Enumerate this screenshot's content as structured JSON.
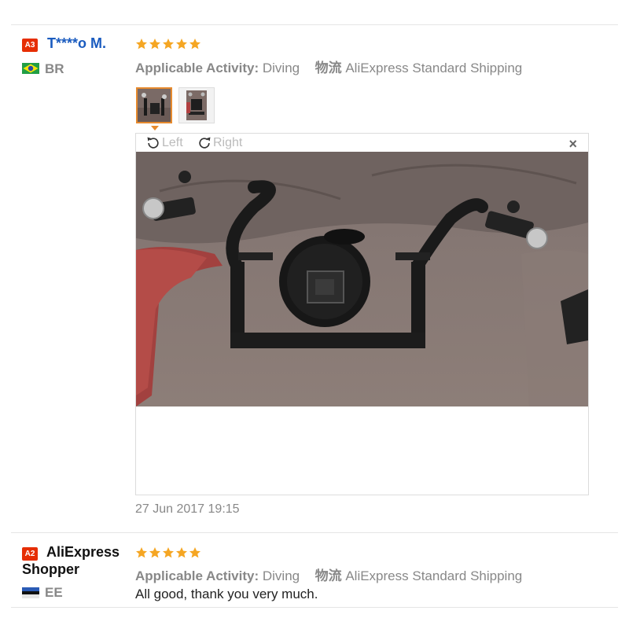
{
  "reviews": [
    {
      "level": "A3",
      "name": "T****o M.",
      "country": "BR",
      "rating": 5,
      "activity_label": "Applicable Activity:",
      "activity_value": "Diving",
      "logistics_label": "物流",
      "logistics_value": "AliExpress Standard Shipping",
      "viewer": {
        "rotate_left": "Left",
        "rotate_right": "Right",
        "close": "×"
      },
      "date": "27 Jun 2017 19:15"
    },
    {
      "level": "A2",
      "name_line1": "AliExpress",
      "name_line2": "Shopper",
      "country": "EE",
      "rating": 5,
      "activity_label": "Applicable Activity:",
      "activity_value": "Diving",
      "logistics_label": "物流",
      "logistics_value": "AliExpress Standard Shipping",
      "comment": "All good, thank you very much."
    }
  ],
  "colors": {
    "accent": "#e62e04",
    "star": "#f5a623",
    "link": "#1a5bbf",
    "muted": "#888888"
  },
  "icons": [
    "star-icon",
    "rotate-left-icon",
    "rotate-right-icon",
    "close-icon",
    "flag-br-icon",
    "flag-ee-icon"
  ]
}
